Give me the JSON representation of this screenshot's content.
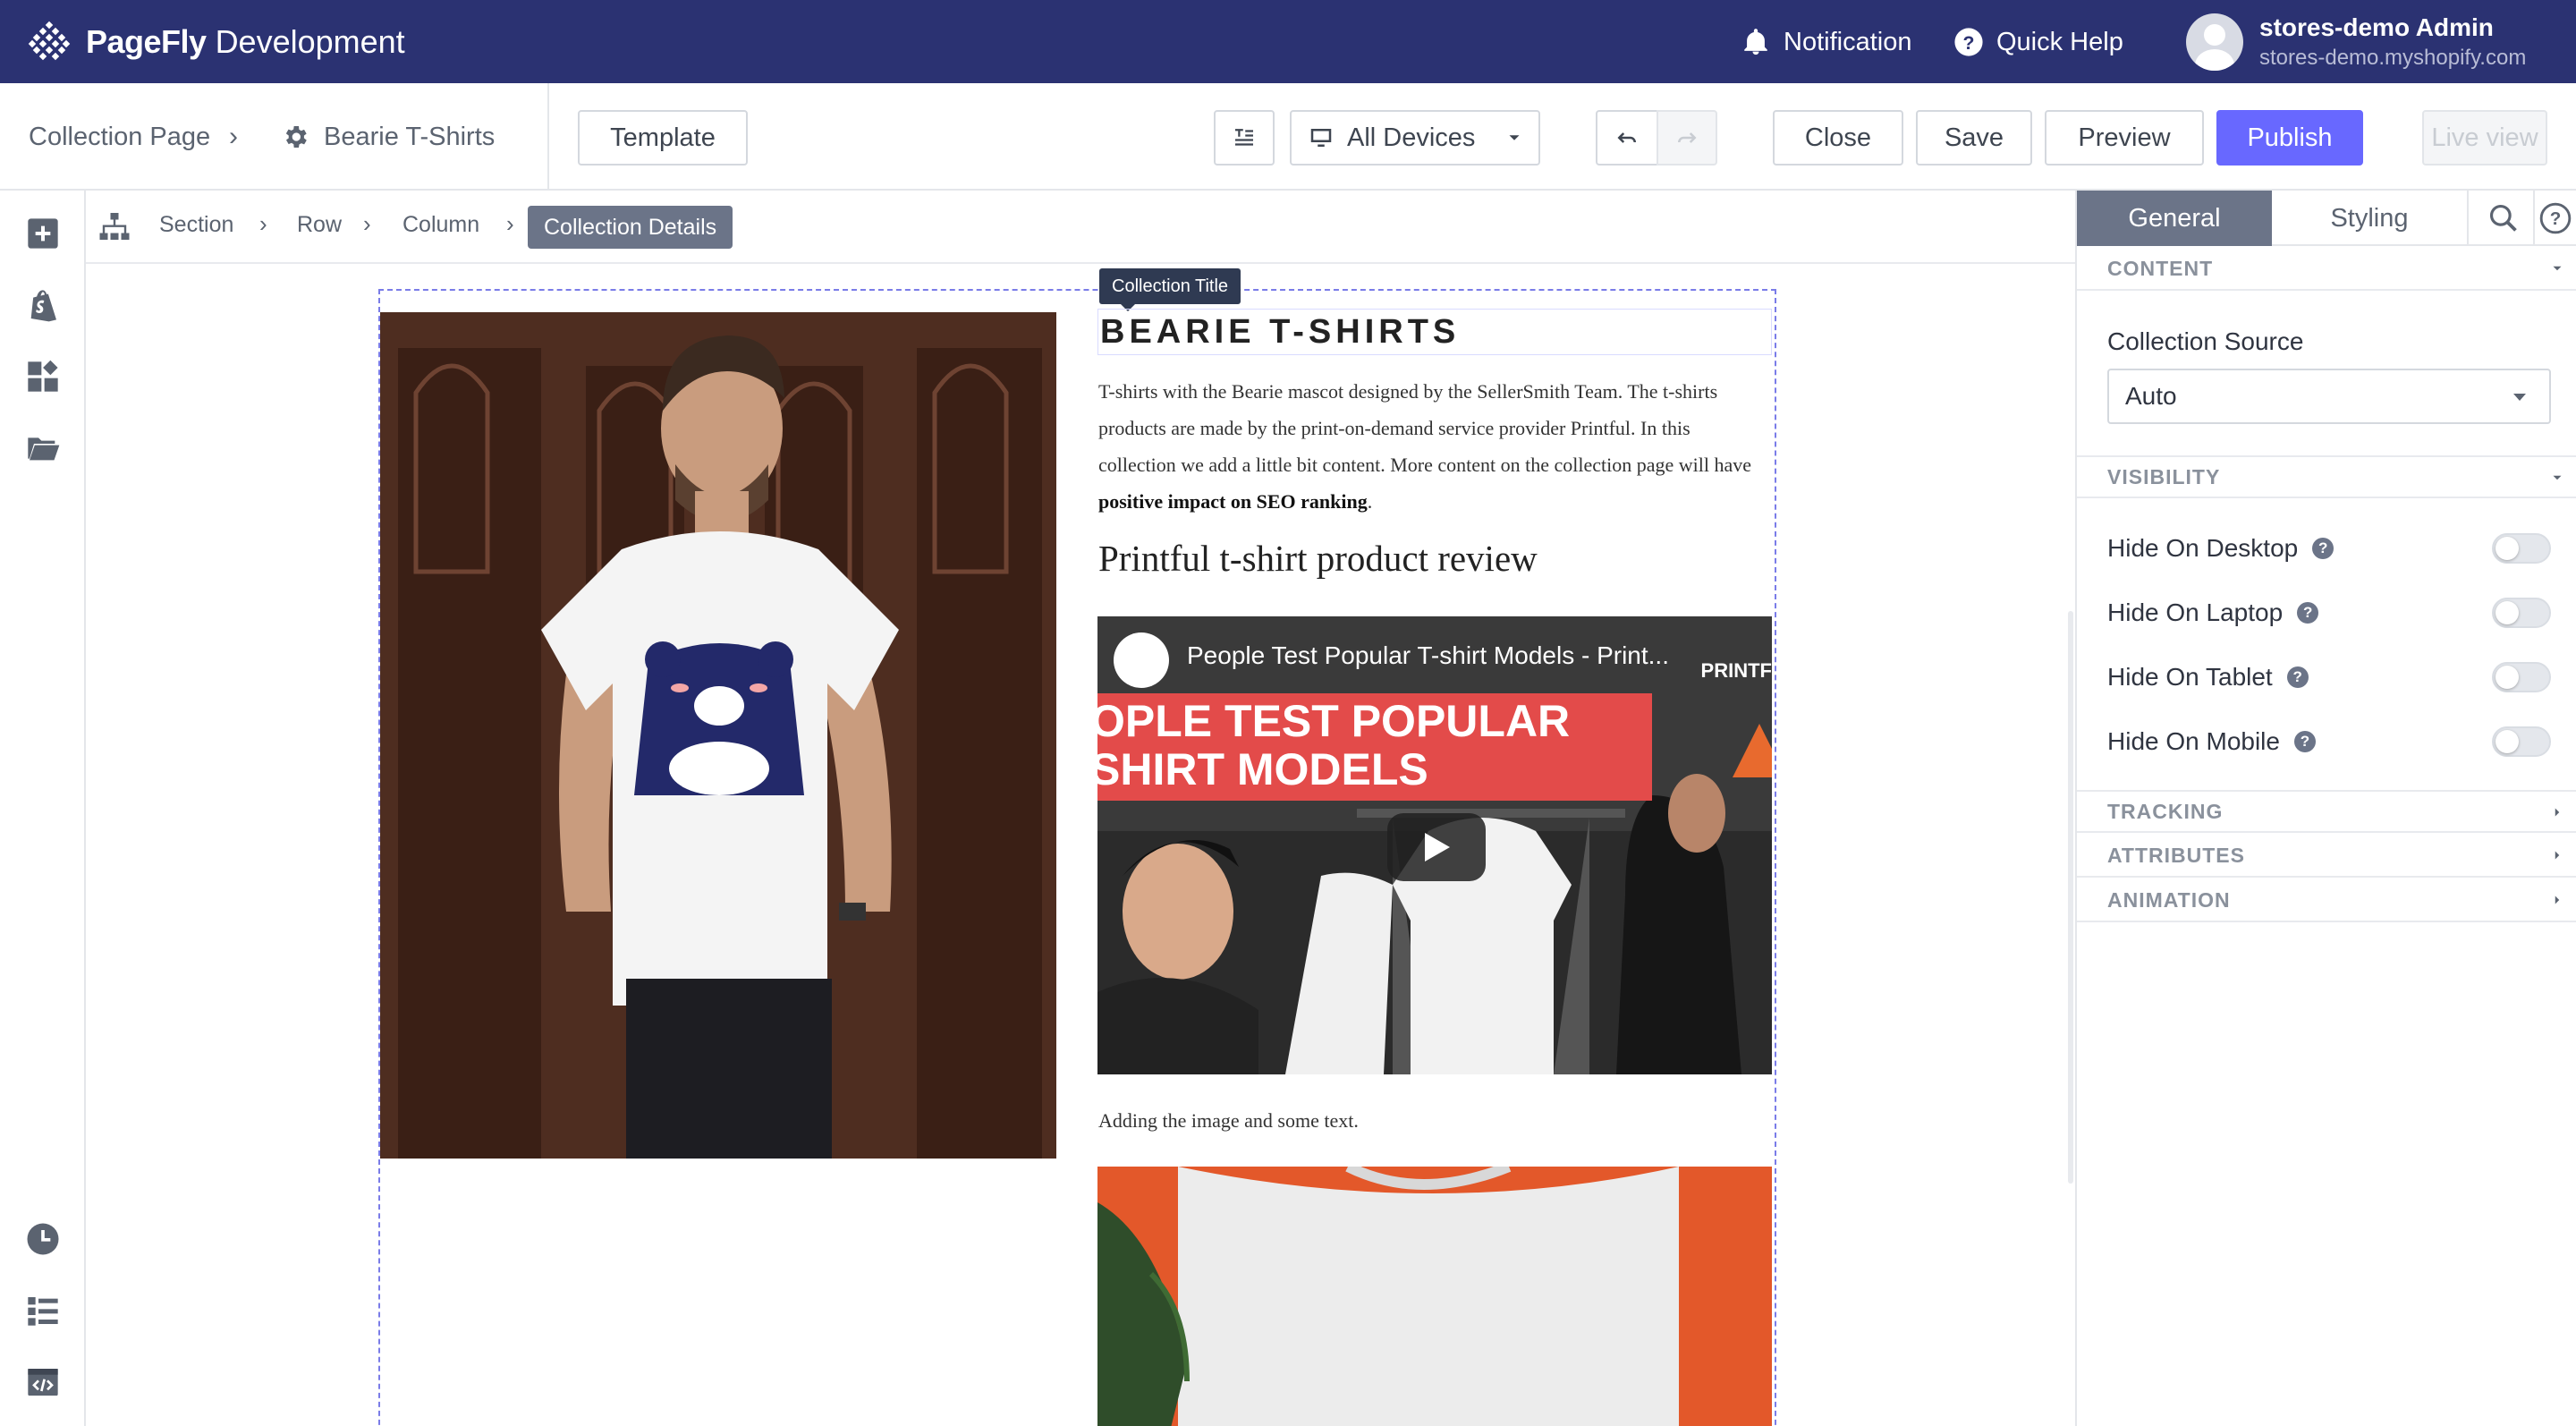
{
  "topbar": {
    "brand_bold": "PageFly",
    "brand_rest": "Development",
    "notification_label": "Notification",
    "help_label": "Quick Help",
    "user_name": "stores-demo Admin",
    "user_shop": "stores-demo.myshopify.com"
  },
  "toolbar": {
    "crumb_page": "Collection Page",
    "crumb_item": "Bearie T-Shirts",
    "template_label": "Template",
    "device_label": "All Devices",
    "close_label": "Close",
    "save_label": "Save",
    "preview_label": "Preview",
    "publish_label": "Publish",
    "live_view_label": "Live view"
  },
  "breadcrumb": {
    "section": "Section",
    "row": "Row",
    "column": "Column",
    "active": "Collection Details"
  },
  "canvas": {
    "title_tag": "Collection Title",
    "title": "BEARIE T-SHIRTS",
    "desc_text": "T-shirts with the Bearie mascot designed by the SellerSmith Team. The t-shirts products are made by the print-on-demand service provider Printful. In this collection we add a little bit content. More content on the collection page will have ",
    "desc_bold": "positive impact on SEO ranking",
    "desc_end": ".",
    "subheading": "Printful t-shirt product review",
    "video_title": "People Test Popular T-shirt Models - Print...",
    "video_banner_line1": "OPLE TEST POPULAR",
    "video_banner_line2": "SHIRT MODELS",
    "video_brand": "PRINTF",
    "caption": "Adding the image and some text."
  },
  "panel": {
    "tab_general": "General",
    "tab_styling": "Styling",
    "content_header": "CONTENT",
    "collection_source_label": "Collection Source",
    "collection_source_value": "Auto",
    "visibility_header": "VISIBILITY",
    "visibility": [
      {
        "label": "Hide On Desktop",
        "checked": false
      },
      {
        "label": "Hide On Laptop",
        "checked": false
      },
      {
        "label": "Hide On Tablet",
        "checked": false
      },
      {
        "label": "Hide On Mobile",
        "checked": false
      }
    ],
    "tracking_header": "TRACKING",
    "attributes_header": "ATTRIBUTES",
    "animation_header": "ANIMATION"
  },
  "colors": {
    "topbar": "#2b3272",
    "publish": "#6868ff",
    "active_tab": "#6b7488",
    "selection": "#7a7ce8"
  },
  "icons": [
    "pagefly-logo-icon",
    "bell-icon",
    "help-icon",
    "gear-icon",
    "text-layout-icon",
    "desktop-icon",
    "undo-icon",
    "redo-icon",
    "add-element-icon",
    "shopify-icon",
    "apps-icon",
    "folder-icon",
    "history-icon",
    "layers-icon",
    "code-icon",
    "sitemap-icon",
    "search-icon",
    "move-icon",
    "duplicate-icon",
    "delete-icon",
    "save-section-icon",
    "shopify-element-icon"
  ]
}
